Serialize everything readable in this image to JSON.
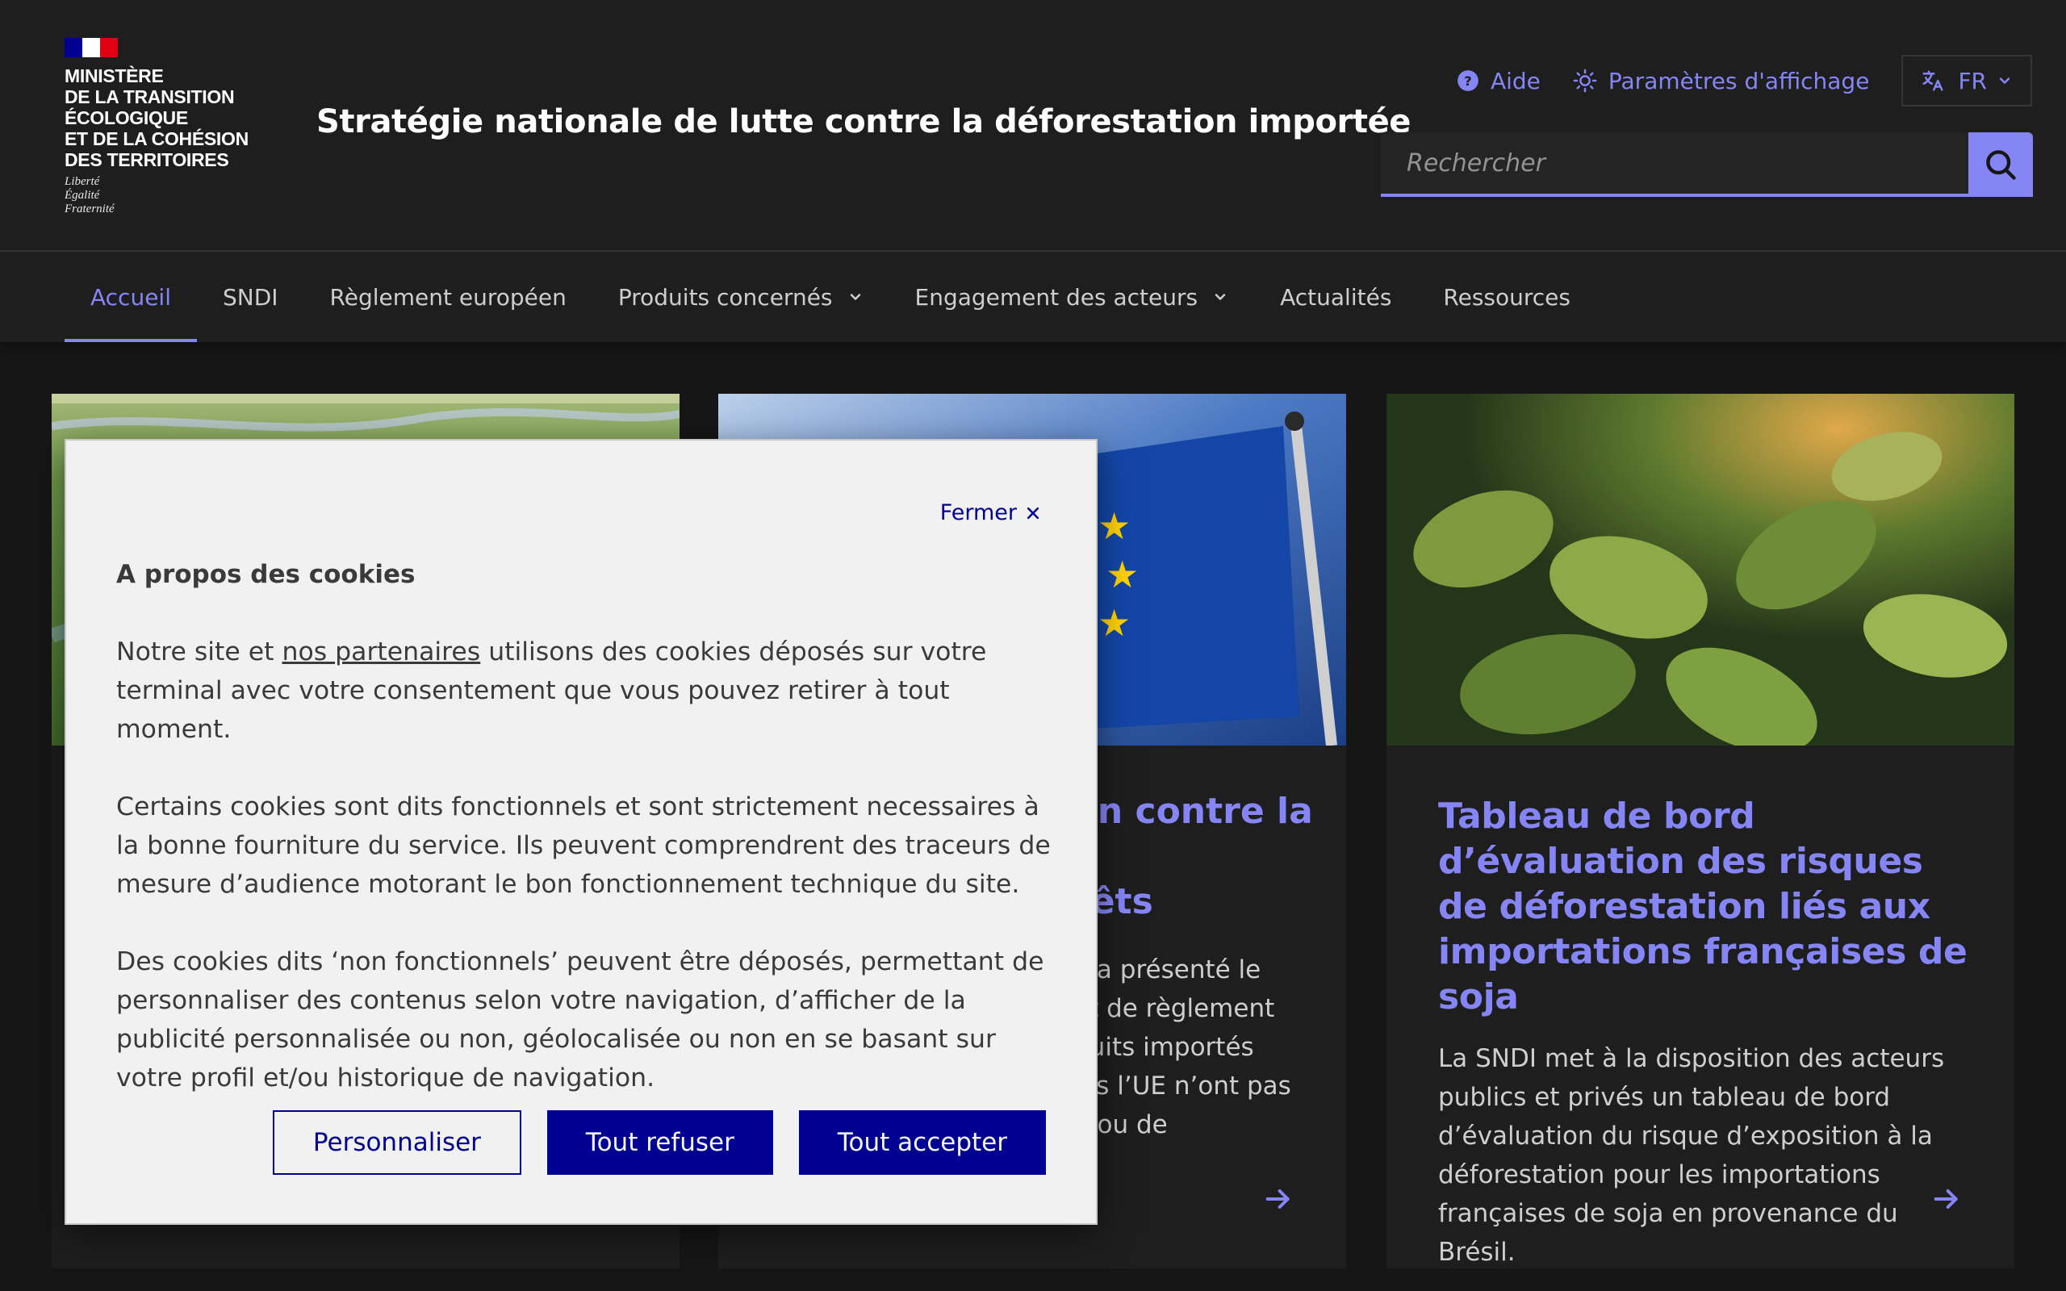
{
  "header": {
    "ministry": "MINISTÈRE\nDE LA TRANSITION\nÉCOLOGIQUE\nET DE LA COHÉSION\nDES TERRITOIRES",
    "motto": "Liberté\nÉgalité\nFraternité",
    "site_title": "Stratégie nationale de lutte contre la déforestation importée",
    "tools": {
      "help": "Aide",
      "display_settings": "Paramètres d'affichage",
      "language": "FR"
    },
    "search": {
      "placeholder": "Rechercher"
    }
  },
  "nav": {
    "items": [
      {
        "label": "Accueil",
        "active": true
      },
      {
        "label": "SNDI"
      },
      {
        "label": "Règlement européen"
      },
      {
        "label": "Produits concernés",
        "dropdown": true
      },
      {
        "label": "Engagement des acteurs",
        "dropdown": true
      },
      {
        "label": "Actualités"
      },
      {
        "label": "Ressources"
      }
    ]
  },
  "cards": [
    {
      "image": "landscape-river-photo"
    },
    {
      "image": "eu-flag-photo",
      "title_visible": "en contre la\n\nrêts",
      "desc_visible": "e a présenté le\net de règlement\nduits importés\nuis l’UE n’ont pas\nn ou de"
    },
    {
      "image": "soy-plants-photo",
      "title": "Tableau de bord d’évaluation des risques de déforestation liés aux importations françaises de soja",
      "description": "La SNDI met à la disposition des acteurs publics et privés un tableau de bord d’évaluation du risque d’exposition à la déforestation pour les importations françaises de soja en provenance du Brésil."
    }
  ],
  "cookie_modal": {
    "close_label": "Fermer",
    "title": "A propos des cookies",
    "p1_before": "Notre site et ",
    "p1_link": "nos partenaires",
    "p1_after": " utilisons des cookies déposés sur votre terminal avec votre consentement que vous pouvez retirer à tout moment.",
    "p2": "Certains cookies sont dits fonctionnels et sont strictement necessaires à la bonne fourniture du service. Ils peuvent comprendrent des traceurs de mesure d’audience motorant le bon fonctionnement technique du site.",
    "p3": "Des cookies dits ‘non fonctionnels’ peuvent être déposés, permettant de personnaliser des contenus selon votre navigation, d’afficher de la publicité personnalisée ou non, géolocalisée ou non en se basant sur votre profil et/ou historique de navigation.",
    "buttons": {
      "customize": "Personnaliser",
      "refuse": "Tout refuser",
      "accept": "Tout accepter"
    }
  },
  "colors": {
    "accent": "#8585f6",
    "modal_primary": "#000091",
    "flag_blue": "#000091",
    "flag_red": "#e1000f"
  }
}
